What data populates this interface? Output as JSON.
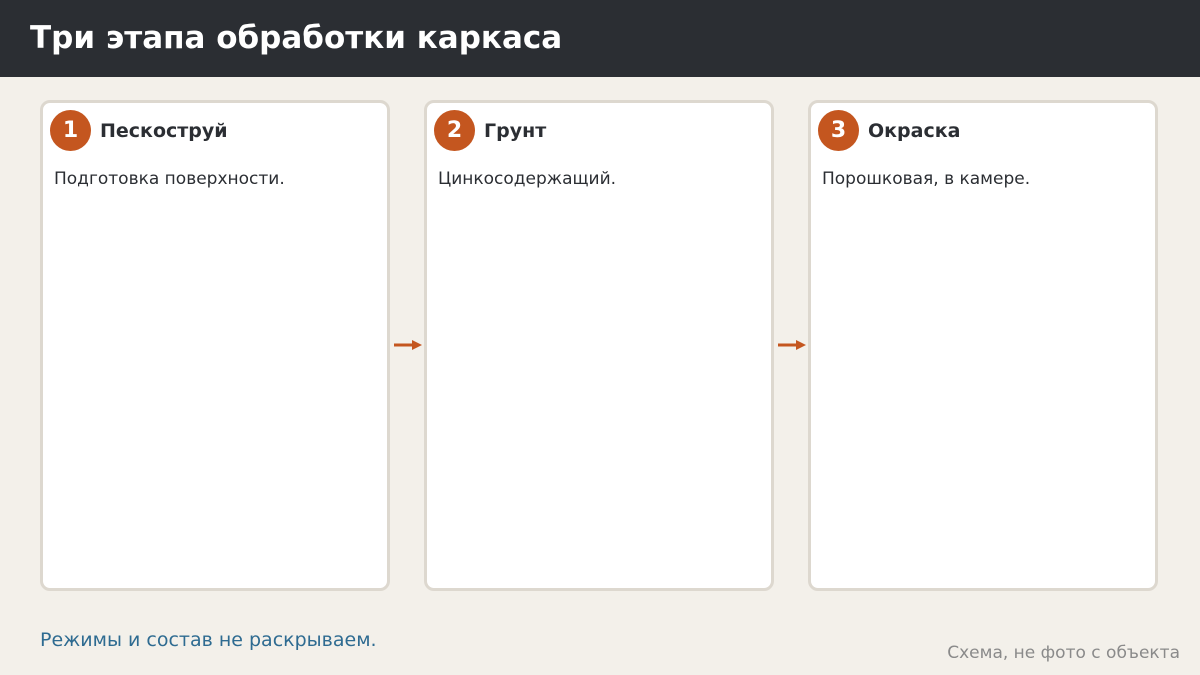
{
  "header": {
    "title": "Три этапа обработки каркаса"
  },
  "steps": [
    {
      "number": "1",
      "title": "Пескоструй",
      "description": "Подготовка поверхности."
    },
    {
      "number": "2",
      "title": "Грунт",
      "description": "Цинкосодержащий."
    },
    {
      "number": "3",
      "title": "Окраска",
      "description": "Порошковая, в камере."
    }
  ],
  "footer": {
    "note": "Режимы и состав не раскрываем.",
    "caption": "Схема, не фото с объекта"
  },
  "colors": {
    "header_bg": "#2b2e33",
    "accent": "#c4561f",
    "note_text": "#2e6b91",
    "background": "#f3f0ea"
  },
  "icons": {
    "connector": "arrow-right-icon"
  }
}
